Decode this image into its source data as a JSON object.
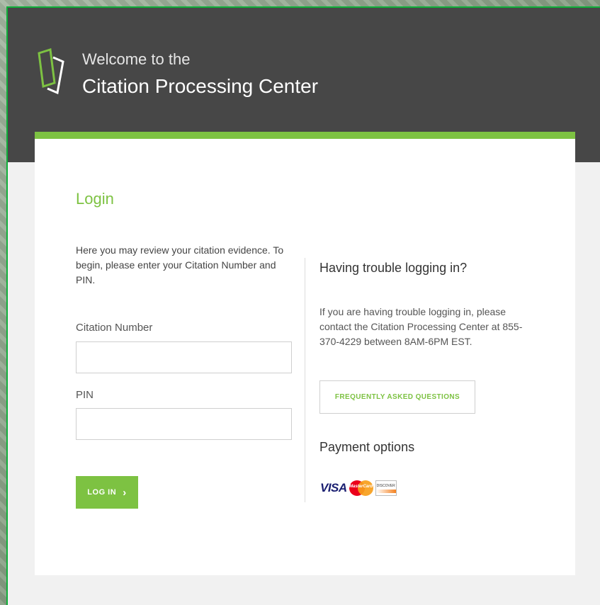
{
  "header": {
    "welcome_line": "Welcome to the",
    "title": "Citation Processing Center",
    "logo_icon": "document-stack-icon"
  },
  "login": {
    "heading": "Login",
    "intro": "Here you may review your citation evidence. To begin, please enter your Citation Number and PIN.",
    "citation_label": "Citation Number",
    "citation_value": "",
    "pin_label": "PIN",
    "pin_value": "",
    "login_button": "LOG IN",
    "login_icon": "chevron-right-icon"
  },
  "help": {
    "heading": "Having trouble logging in?",
    "text": "If you are having trouble logging in, please contact the Citation Processing Center at 855-370-4229 between 8AM-6PM EST.",
    "faq_button": "FREQUENTLY ASKED QUESTIONS"
  },
  "payment": {
    "heading": "Payment options",
    "visa": "VISA",
    "mastercard": "MasterCard",
    "discover": "DISCOVER"
  },
  "colors": {
    "accent_green": "#7dc242",
    "header_bg": "#474747",
    "frame_green": "#0fb03a"
  }
}
